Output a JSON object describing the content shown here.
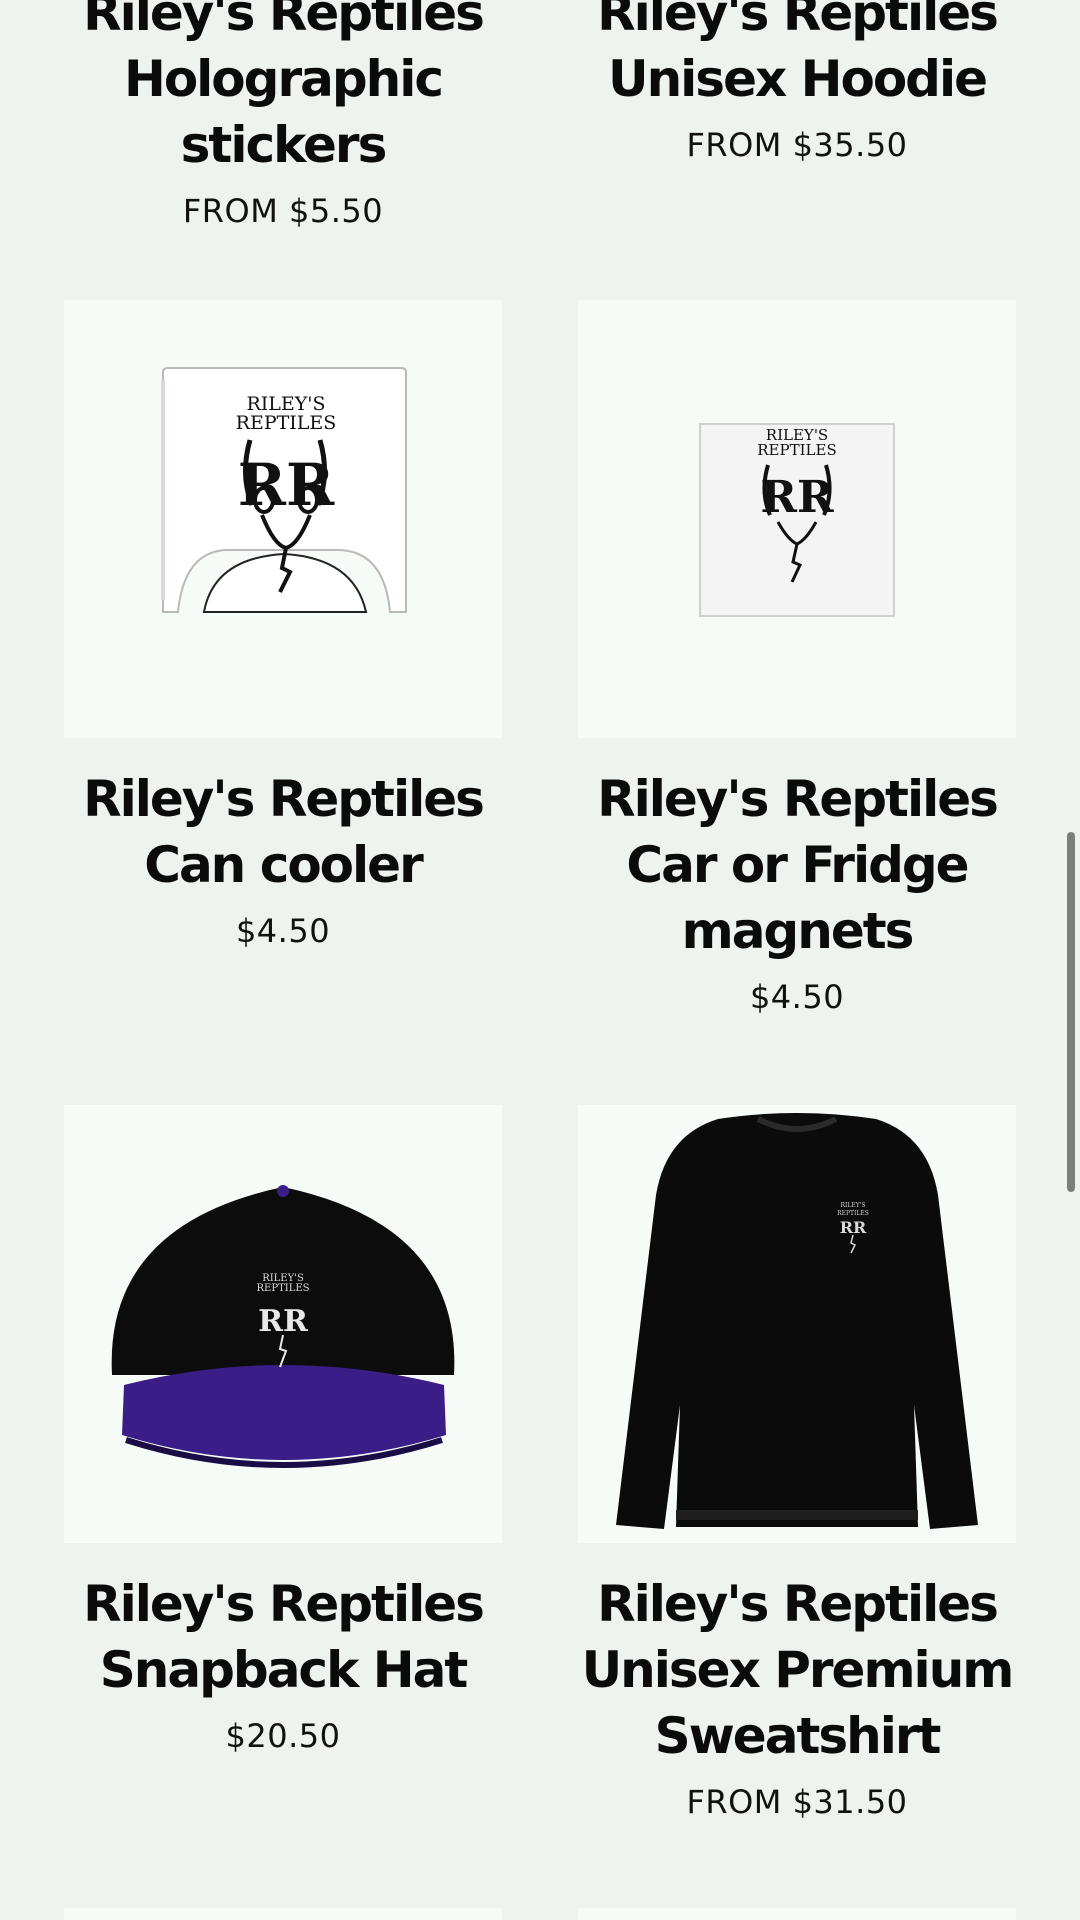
{
  "products": [
    {
      "title": "Riley's Reptiles Holographic stickers",
      "title_lines": [
        "Riley's Reptiles",
        "Holographic",
        "stickers"
      ],
      "price": "FROM $5.50"
    },
    {
      "title": "Riley's Reptiles Unisex Hoodie",
      "title_lines": [
        "Riley's Reptiles",
        "Unisex Hoodie"
      ],
      "price": "FROM $35.50"
    },
    {
      "title": "Riley's Reptiles Can cooler",
      "title_lines": [
        "Riley's Reptiles",
        "Can cooler"
      ],
      "price": "$4.50",
      "image_icon": "can-cooler-image"
    },
    {
      "title": "Riley's Reptiles Car or Fridge magnets",
      "title_lines": [
        "Riley's Reptiles",
        "Car or Fridge",
        "magnets"
      ],
      "price": "$4.50",
      "image_icon": "magnet-image"
    },
    {
      "title": "Riley's Reptiles Snapback Hat",
      "title_lines": [
        "Riley's Reptiles",
        "Snapback Hat"
      ],
      "price": "$20.50",
      "image_icon": "snapback-hat-image"
    },
    {
      "title": "Riley's Reptiles Unisex Premium Sweatshirt",
      "title_lines": [
        "Riley's Reptiles",
        "Unisex Premium",
        "Sweatshirt"
      ],
      "price": "FROM $31.50",
      "image_icon": "sweatshirt-image"
    }
  ],
  "logo": {
    "line1": "RILEY'S",
    "line2": "REPTILES",
    "mark": "RR"
  },
  "colors": {
    "background": "#eff3ef",
    "card_image_bg": "#f7fbf7",
    "text": "#0b0b0b",
    "hat_brim": "#3a1d86"
  }
}
